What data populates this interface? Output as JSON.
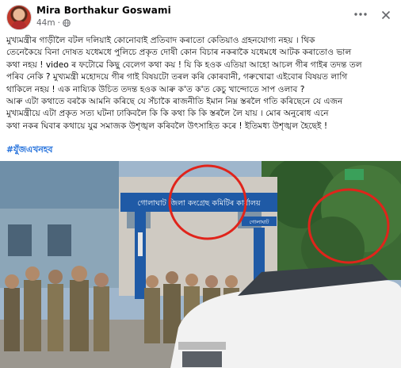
{
  "post": {
    "author": "Mira Borthakur Goswami",
    "time": "44m",
    "meta_separator": "·",
    "lines": [
      "মুখ্যমন্ত্ৰীৰ গাড়ীলৈ বটল দলিয়াই কোনোবাই প্ৰতিবাদ কৰাতো কেতিয়াও গ্ৰহনযোগ্য নহয় । থিক",
      "তেনেকৈয়ে বিনা দোষত যধেমধে পুলিচে প্ৰকৃত দোষী কোন বিচাৰ নকৰাকৈ যধেমধে আটক কৰাতোও ভাল",
      "কথা নহয় ! video ৰ ফটোৱে কিছু বেলেগ কথা কয় ! যি কি হওক এতিয়া আহো আচল গীৰ গাইৰ তদন্ত তল",
      "পৰিব নেকি ? মুখ্যমন্ত্ৰী মহোদয়ে গীৰ গাই বিষয়টো তৰল কৰি কোৰবানী, গৰুখোৱা এইবোৰ বিষয়ত লাগি",
      "থাকিলে নহয় ! এক নায্যিক উচিত তদন্ত হওক আৰু ক'ত ক'ত কেচু খান্দোতে সাপ ওলাব ?",
      "আৰু এটা কথাতে বৰকৈ আমনি কৰিছে যে সঁচাকৈ ৰাজনীতি ইমান নিম্ন স্তৰলৈ গতি কৰিছেনে যে এজন",
      "মুখ্যমন্ত্ৰীয়ে এটা প্ৰকৃত সত্য ঘটনা ঢাকিবলৈ কি কি কথা কি কি স্তৰলৈ লৈ যায় । মোৰ অনুৰোধ এনে",
      "কথা নকৰ ঘিবাৰ কথায়ে যুৱ সমাজক উশৃঙ্খল কৰিবলৈ উৎসাহিত কৰে ! ইতিমধ্য উশৃঙ্খল হৈছেই !"
    ],
    "hashtag": "#যুঁজএখনহব"
  },
  "photo": {
    "sign_text": "গোলাঘাট জিলা কংগ্ৰেছ কমিটিৰ কাৰ্যালয়",
    "small_sign_text": "গোলাঘাট"
  },
  "icons": {
    "more": "more-horizontal-icon",
    "close": "close-icon",
    "globe": "globe-icon"
  },
  "colors": {
    "hashtag": "#216fdb",
    "annotation_circle": "#e0241b"
  }
}
